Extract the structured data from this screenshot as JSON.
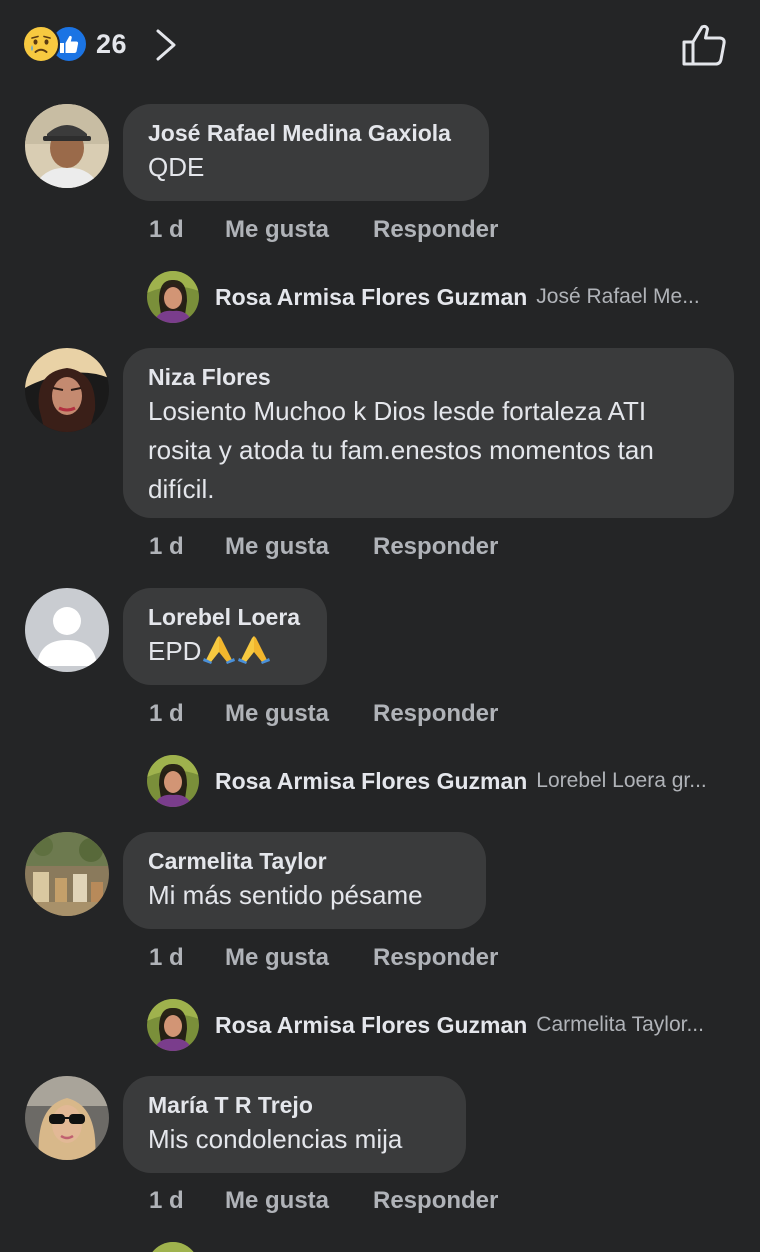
{
  "header": {
    "reaction_count": "26",
    "reaction_icons": [
      "sad-face-icon",
      "like-icon"
    ]
  },
  "actions": {
    "like_label": "Me gusta",
    "reply_label": "Responder"
  },
  "comments": [
    {
      "author": "José Rafael Medina Gaxiola",
      "text": "QDE",
      "time": "1 d",
      "reply": {
        "author": "Rosa Armisa Flores Guzman",
        "snippet": "José Rafael Me..."
      }
    },
    {
      "author": "Niza Flores",
      "text": "Losiento Muchoo k Dios lesde fortaleza ATI rosita y atoda tu fam.enestos momentos tan difícil.",
      "time": "1 d"
    },
    {
      "author": "Lorebel Loera",
      "text": "EPD",
      "text_emoji": [
        "folded-hands-icon",
        "folded-hands-icon"
      ],
      "time": "1 d",
      "reply": {
        "author": "Rosa Armisa Flores Guzman",
        "snippet": "Lorebel Loera gr..."
      }
    },
    {
      "author": "Carmelita Taylor",
      "text": "Mi más sentido pésame",
      "time": "1 d",
      "reply": {
        "author": "Rosa Armisa Flores Guzman",
        "snippet": "Carmelita Taylor..."
      }
    },
    {
      "author": "María T R Trejo",
      "text": "Mis condolencias mija",
      "time": "1 d"
    }
  ],
  "colors": {
    "background": "#242526",
    "bubble": "#3a3b3c",
    "primary_text": "#e4e6eb",
    "secondary_text": "#b0b3b8",
    "like_blue": "#1b74e4",
    "sad_yellow": "#f7c940"
  }
}
